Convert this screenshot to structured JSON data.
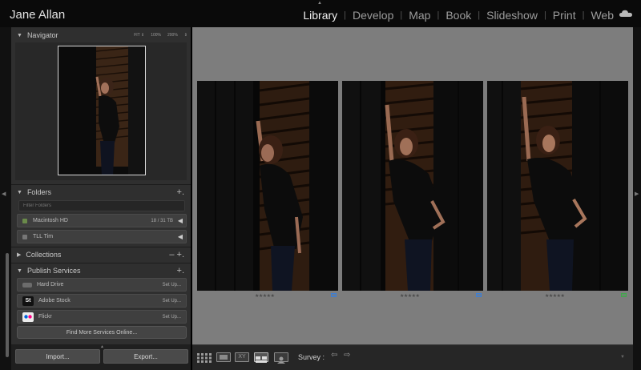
{
  "identity_plate": "Jane Allan",
  "modules": [
    {
      "label": "Library",
      "active": true
    },
    {
      "label": "Develop",
      "active": false
    },
    {
      "label": "Map",
      "active": false
    },
    {
      "label": "Book",
      "active": false
    },
    {
      "label": "Slideshow",
      "active": false
    },
    {
      "label": "Print",
      "active": false
    },
    {
      "label": "Web",
      "active": false
    }
  ],
  "module_separator": "|",
  "navigator": {
    "title": "Navigator",
    "zoom_options": [
      "FIT ⇕",
      "100%",
      "200%",
      "⇕"
    ]
  },
  "folders": {
    "title": "Folders",
    "add": "+.",
    "search_placeholder": "Filter Folders",
    "volumes": [
      {
        "name": "Macintosh HD",
        "info": "18 / 31 TB",
        "online": true
      },
      {
        "name": "TLL Tim",
        "info": "",
        "online": false
      }
    ]
  },
  "collections": {
    "title": "Collections",
    "controls": "–  +."
  },
  "publish_services": {
    "title": "Publish Services",
    "add": "+.",
    "services": [
      {
        "name": "Hard Drive",
        "action": "Set Up...",
        "icon": "hard-drive-icon"
      },
      {
        "name": "Adobe Stock",
        "action": "Set Up...",
        "icon": "adobe-stock-icon",
        "badge": "St"
      },
      {
        "name": "Flickr",
        "action": "Set Up...",
        "icon": "flickr-icon"
      }
    ],
    "find_more": "Find More Services Online..."
  },
  "buttons": {
    "import": "Import...",
    "export": "Export..."
  },
  "photos": [
    {
      "rating": "★★★★★",
      "label_color": "#3d7fd6"
    },
    {
      "rating": "★★★★★",
      "label_color": "#3d7fd6"
    },
    {
      "rating": "★★★★★",
      "label_color": "#3fa84a"
    }
  ],
  "toolbar": {
    "view_mode": "Survey :",
    "compare_label": "XY"
  }
}
